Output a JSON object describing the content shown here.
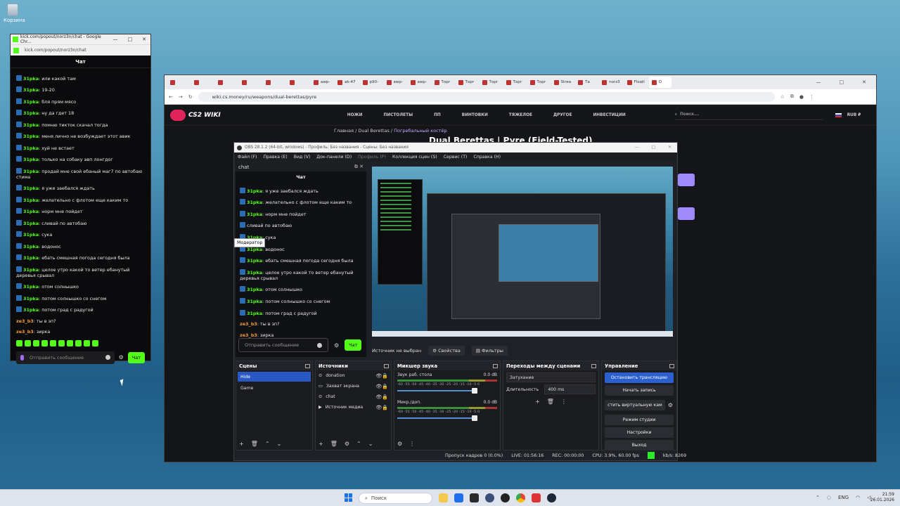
{
  "desktop": {
    "recycle_bin": "Корзина"
  },
  "chat_window": {
    "title": "kick.com/popout/norz3n/chat - Google Chr...",
    "url": "kick.com/popout/norz3n/chat",
    "header": "Чат",
    "messages": [
      {
        "user": "31pka",
        "text": ": или какой там",
        "cls": "green"
      },
      {
        "user": "31pka",
        "text": ": 19-20",
        "cls": "green"
      },
      {
        "user": "31pka",
        "text": ": бля прям мясо",
        "cls": "green"
      },
      {
        "user": "31pka",
        "text": ": ну да гдет 18",
        "cls": "green"
      },
      {
        "user": "31pka",
        "text": ": помню тикток скачал тогда",
        "cls": "green"
      },
      {
        "user": "31pka",
        "text": ": меня лично не возбуждает этот авик",
        "cls": "green"
      },
      {
        "user": "31pka",
        "text": ": хуй не встает",
        "cls": "green"
      },
      {
        "user": "31pka",
        "text": ": только на собаку авп лонгдог",
        "cls": "green"
      },
      {
        "user": "31pka",
        "text": ": продай мне свой ебаный маг7 по автобаю стима",
        "cls": "green"
      },
      {
        "user": "31pka",
        "text": ": я уже заебался ждать",
        "cls": "green"
      },
      {
        "user": "31pka",
        "text": ": желательно с флотом еще каким то",
        "cls": "green"
      },
      {
        "user": "31pka",
        "text": ": норм мне пойдет",
        "cls": "green"
      },
      {
        "user": "31pka",
        "text": ": сливай по автобаю",
        "cls": "green"
      },
      {
        "user": "31pka",
        "text": ": сука",
        "cls": "green"
      },
      {
        "user": "31pka",
        "text": ": водонос",
        "cls": "green"
      },
      {
        "user": "31pka",
        "text": ": ебать смешная погода сегодня была",
        "cls": "green"
      },
      {
        "user": "31pka",
        "text": ": целое утро какой то ветер ебанутый деревья срывал",
        "cls": "green"
      },
      {
        "user": "31pka",
        "text": ": отом солнышко",
        "cls": "green"
      },
      {
        "user": "31pka",
        "text": ": потом солнышко со снегом",
        "cls": "green"
      },
      {
        "user": "31pka",
        "text": ": потом град с радугой",
        "cls": "green"
      },
      {
        "user": "ze3_b3",
        "text": ": ты в зп?",
        "cls": "orange"
      },
      {
        "user": "ze3_b3",
        "text": ": зирка",
        "cls": "orange"
      }
    ],
    "input_placeholder": "Отправить сообщение",
    "send_label": "Чат"
  },
  "browser": {
    "tabs": [
      "",
      "",
      "",
      "",
      "",
      "",
      "awp-",
      "ak-47",
      "p90-",
      "awp-",
      "awp-",
      "Торг",
      "Торг",
      "Торг",
      "Торг",
      "Торг",
      "Strea",
      "Та",
      "norz3",
      "FloatI",
      "D"
    ],
    "url": "wiki.cs.money/ru/weapons/dual-berettas/pyre",
    "logo": "CS2 WIKI",
    "nav": [
      "НОЖИ",
      "ПИСТОЛЕТЫ",
      "ПП",
      "ВИНТОВКИ",
      "ТЯЖЕЛОЕ",
      "ДРУГОЕ",
      "ИНВЕСТИЦИИ"
    ],
    "search_placeholder": "Поиск...",
    "currency": "RUB ₽",
    "breadcrumb_a": "Главная / Dual Berettas / ",
    "breadcrumb_b": "Погребальный костёр",
    "page_title": "Dual Berettas | Pyre (Field-Tested)"
  },
  "obs": {
    "title": "OBS 28.1.2 (64-bit, windows) - Профиль: Без названия - Сцены: Без названия",
    "menu": [
      "Файл (F)",
      "Правка (E)",
      "Вид (V)",
      "Док-панели (D)",
      "Профиль (P)",
      "Коллекция сцен (S)",
      "Сервис (T)",
      "Справка (H)"
    ],
    "dock_title": "chat",
    "dock_header": "Чат",
    "dock_messages": [
      {
        "user": "31pka",
        "text": ": я уже заебался ждать",
        "cls": "green"
      },
      {
        "user": "31pka",
        "text": ": желательно с флотом еще каким то",
        "cls": "green"
      },
      {
        "user": "31pka",
        "text": ": норм мне пойдет",
        "cls": "green"
      },
      {
        "user": "",
        "text": "сливай по автобаю",
        "cls": "green"
      },
      {
        "user": "31pka",
        "text": ": сука",
        "cls": "green"
      },
      {
        "user": "31pka",
        "text": ": водонос",
        "cls": "green"
      },
      {
        "user": "31pka",
        "text": ": ебать смешная погода сегодня была",
        "cls": "green"
      },
      {
        "user": "31pka",
        "text": ": целое утро какой то ветер ебанутый деревья срывал",
        "cls": "green"
      },
      {
        "user": "31pka",
        "text": ": отом солнышко",
        "cls": "green"
      },
      {
        "user": "31pka",
        "text": ": потом солнышко со снегом",
        "cls": "green"
      },
      {
        "user": "31pka",
        "text": ": потом град с радугой",
        "cls": "green"
      },
      {
        "user": "ze3_b3",
        "text": ": ты в зп?",
        "cls": "orange"
      },
      {
        "user": "ze3_b3",
        "text": ": зирка",
        "cls": "orange"
      }
    ],
    "moderator_tooltip": "Модератор",
    "dock_input_placeholder": "Отправить сообщение",
    "dock_send_label": "Чат",
    "no_source": "Источник не выбран",
    "properties": "Свойства",
    "filters": "Фильтры",
    "scenes_title": "Сцены",
    "scenes": [
      "Hide",
      "Game"
    ],
    "sources_title": "Источники",
    "sources": [
      "donation",
      "Захват экрана",
      "chat",
      "Источник медиа"
    ],
    "mixer_title": "Микшер звука",
    "mixer": [
      {
        "name": "Звук раб. стола",
        "level": "0.0 dB"
      },
      {
        "name": "Микр./доп.",
        "level": "0.0 dB"
      }
    ],
    "mixer_ticks": "-60 -55 -50 -45 -40 -35 -30 -25 -20 -15 -10 -5 0",
    "transitions_title": "Переходы между сценами",
    "transition": "Затухание",
    "duration_label": "Длительность",
    "duration": "400 ms",
    "controls_title": "Управление",
    "controls": [
      "Остановить трансляцию",
      "Начать запись",
      "стить виртуальную кам",
      "Режим студии",
      "Настройки",
      "Выход"
    ],
    "status": {
      "dropped": "Пропуск кадров 0 (0.0%)",
      "live": "LIVE: 01:56:16",
      "rec": "REC: 00:00:00",
      "cpu": "CPU: 3.9%, 60.00 fps",
      "kbs": "kb/s: 8269"
    }
  },
  "taskbar": {
    "search": "Поиск",
    "lang": "ENG",
    "time": "21:59",
    "date": "26.01.2026"
  }
}
